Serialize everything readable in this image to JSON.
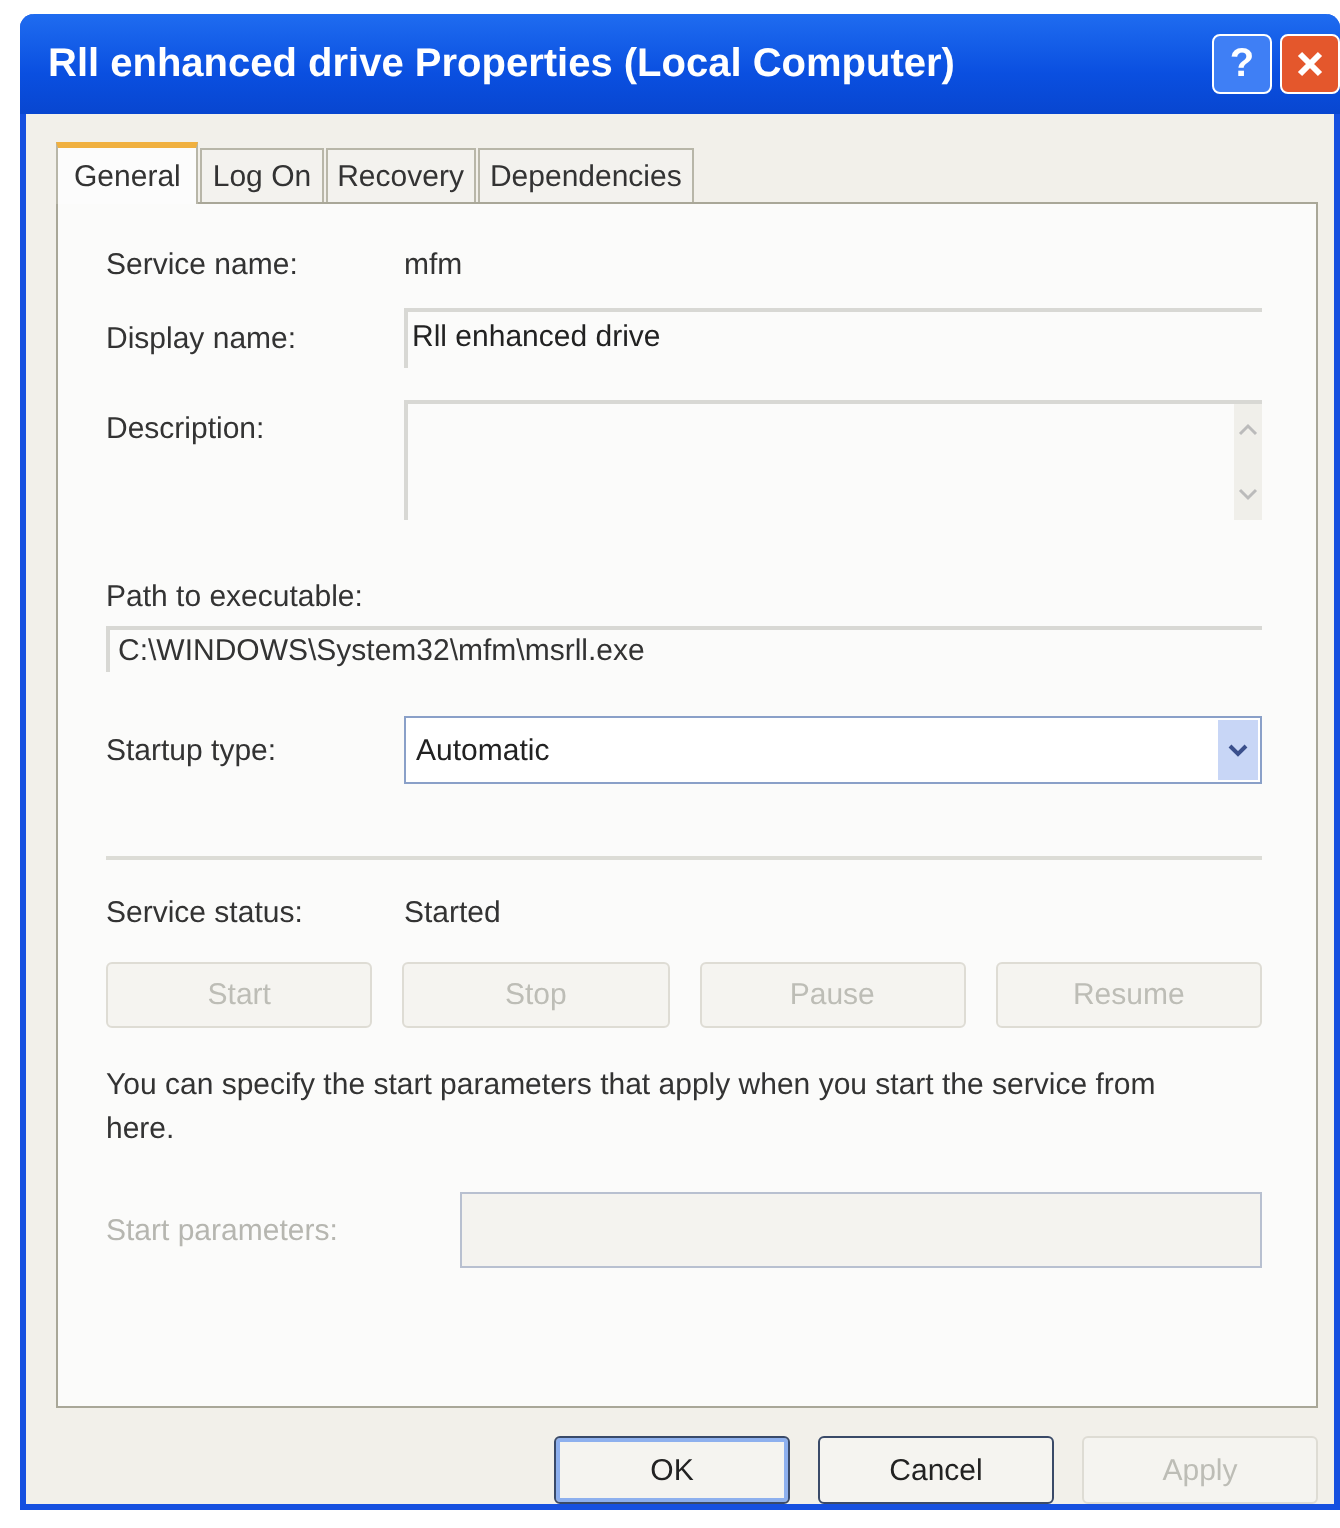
{
  "window": {
    "title": "Rll enhanced drive Properties (Local Computer)",
    "help": "?"
  },
  "tabs": [
    {
      "label": "General",
      "selected": true
    },
    {
      "label": "Log On",
      "selected": false
    },
    {
      "label": "Recovery",
      "selected": false
    },
    {
      "label": "Dependencies",
      "selected": false
    }
  ],
  "service_name": {
    "label": "Service name:",
    "value": "mfm"
  },
  "display_name": {
    "label": "Display name:",
    "value": "Rll enhanced drive"
  },
  "description": {
    "label": "Description:"
  },
  "path": {
    "label": "Path to executable:",
    "value": "C:\\WINDOWS\\System32\\mfm\\msrll.exe"
  },
  "startup_type": {
    "label": "Startup type:",
    "value": "Automatic"
  },
  "service_status": {
    "label": "Service status:",
    "value": "Started"
  },
  "control_buttons": [
    {
      "label": "Start",
      "disabled": true
    },
    {
      "label": "Stop",
      "disabled": true
    },
    {
      "label": "Pause",
      "disabled": true
    },
    {
      "label": "Resume",
      "disabled": true
    }
  ],
  "note": "You can specify the start parameters that apply when you start the service from here.",
  "start_parameters": {
    "label": "Start parameters:",
    "disabled": true
  },
  "dialog_buttons": [
    {
      "label": "OK",
      "default": true,
      "disabled": false
    },
    {
      "label": "Cancel",
      "default": false,
      "disabled": false
    },
    {
      "label": "Apply",
      "default": false,
      "disabled": true
    }
  ]
}
